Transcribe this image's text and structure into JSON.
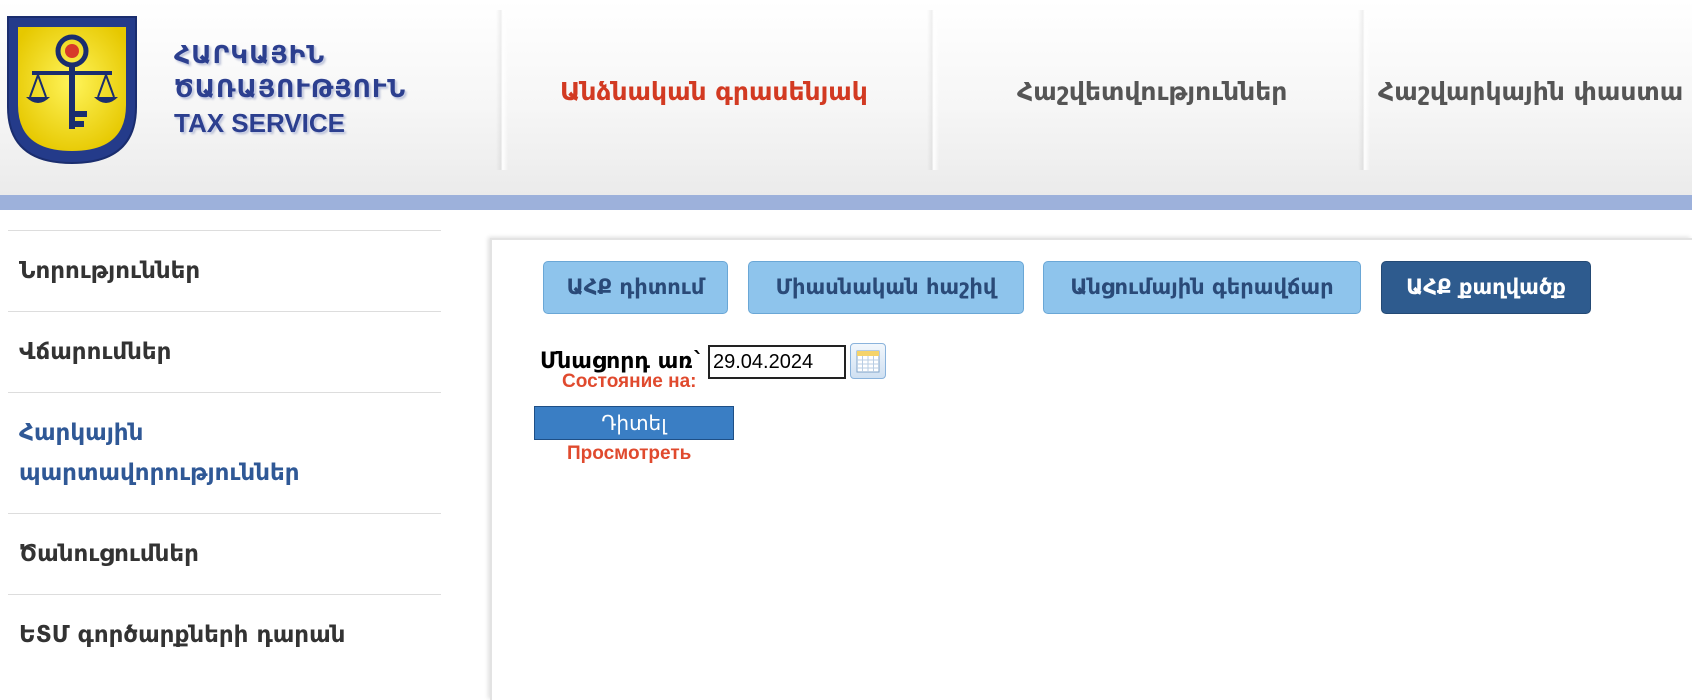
{
  "header": {
    "org_name_line1": "ՀԱՐԿԱՅԻՆ",
    "org_name_line2": "ԾԱՌԱՅՈՒԹՅՈՒՆ",
    "org_name_line3": "TAX SERVICE",
    "nav": [
      {
        "label": "Անձնական գրասենյակ",
        "active": true
      },
      {
        "label": "Հաշվետվություններ",
        "active": false
      },
      {
        "label": "Հաշվարկային փաստա",
        "active": false
      }
    ]
  },
  "sidebar": {
    "items": [
      {
        "label": "Նորություններ"
      },
      {
        "label": "Վճարումներ"
      },
      {
        "label_line1": "Հարկային",
        "label_line2": "պարտավորություններ",
        "active": true
      },
      {
        "label": "Ծանուցումներ"
      },
      {
        "label": "ԵՏՄ գործարքների դարան"
      }
    ]
  },
  "main": {
    "tabs": [
      {
        "label": "ԱՀՔ դիտում",
        "selected": false
      },
      {
        "label": "Միասնական հաշիվ",
        "selected": false
      },
      {
        "label": "Անցումային գերավճար",
        "selected": false
      },
      {
        "label": "ԱՀՔ քաղվածք",
        "selected": true
      }
    ],
    "date_label": "Մնացորդ առ`",
    "date_label_ru": "Состояние на:",
    "date_value": "29.04.2024",
    "view_button": "Դիտել",
    "view_button_ru": "Просмотреть"
  },
  "colors": {
    "nav_active": "#d23a22",
    "header_bar": "#9db1db",
    "sidebar_active": "#2f5896",
    "tab_light": "#8ec4ec",
    "tab_dark": "#2e5b8e",
    "button_blue": "#3a7ec4",
    "russian_label": "#e04a2e"
  }
}
